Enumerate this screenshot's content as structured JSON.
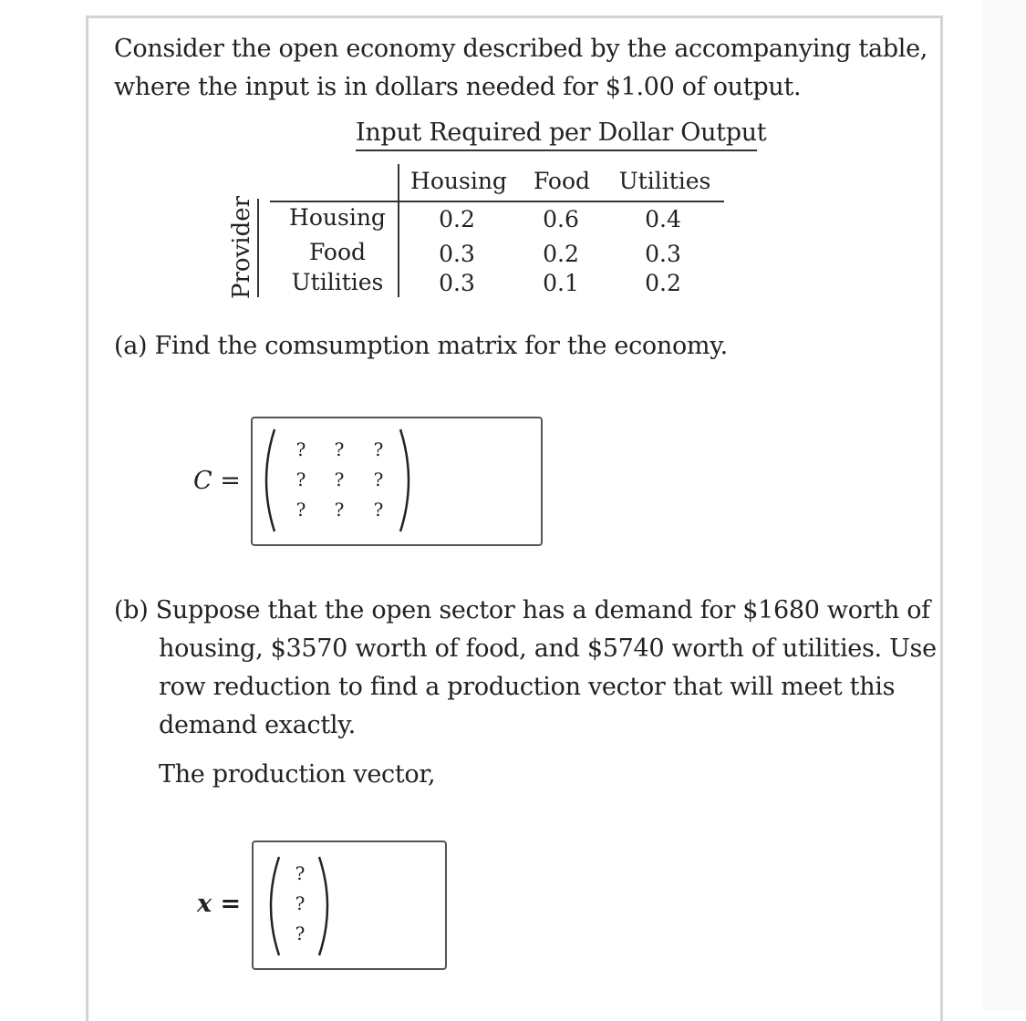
{
  "problem": {
    "intro_line1": "Consider the open economy described by the accompanying table,",
    "intro_line2": "where the input is in dollars needed for $1.00 of output."
  },
  "table": {
    "title": "Input Required per Dollar Output",
    "row_axis_label": "Provider",
    "columns": [
      "Housing",
      "Food",
      "Utilities"
    ],
    "rows": [
      {
        "label": "Housing",
        "values": [
          "0.2",
          "0.6",
          "0.4"
        ]
      },
      {
        "label": "Food",
        "values": [
          "0.3",
          "0.2",
          "0.3"
        ]
      },
      {
        "label": "Utilities",
        "values": [
          "0.3",
          "0.1",
          "0.2"
        ]
      }
    ]
  },
  "part_a": {
    "prompt": "(a) Find the comsumption matrix for the economy.",
    "lhs": "C =",
    "matrix": [
      [
        "?",
        "?",
        "?"
      ],
      [
        "?",
        "?",
        "?"
      ],
      [
        "?",
        "?",
        "?"
      ]
    ]
  },
  "part_b": {
    "line1": "(b) Suppose that the open sector has a demand for $1680 worth of",
    "line2": "housing, $3570 worth of food, and $5740 worth of utilities. Use",
    "line3": "row reduction to find a production vector that will meet this",
    "line4": "demand exactly.",
    "production_label": "The production vector,",
    "lhs": "x =",
    "vector": [
      "?",
      "?",
      "?"
    ]
  }
}
